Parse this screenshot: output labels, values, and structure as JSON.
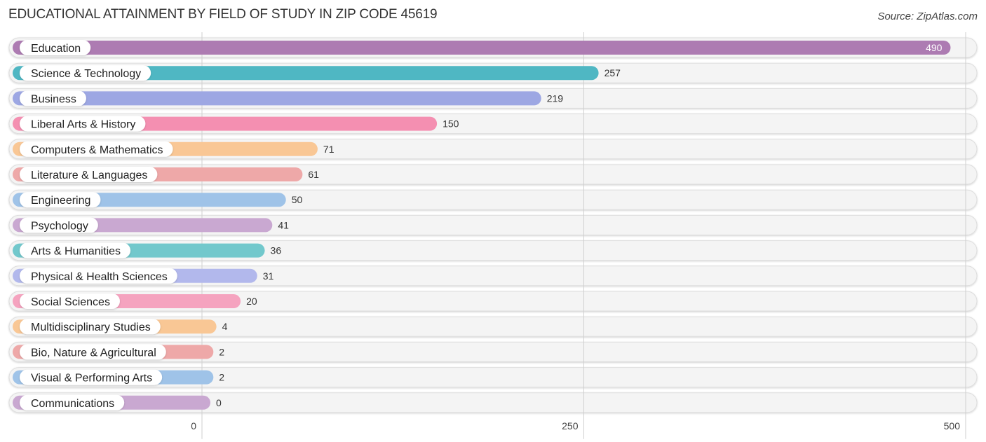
{
  "chart_data": {
    "type": "bar",
    "orientation": "horizontal",
    "title": "EDUCATIONAL ATTAINMENT BY FIELD OF STUDY IN ZIP CODE 45619",
    "source": "Source: ZipAtlas.com",
    "xlabel": "",
    "ylabel": "",
    "xlim": [
      0,
      500
    ],
    "xticks": [
      0,
      250,
      500
    ],
    "xtick_labels": [
      "0",
      "250",
      "500"
    ],
    "grid": true,
    "categories": [
      "Education",
      "Science & Technology",
      "Business",
      "Liberal Arts & History",
      "Computers & Mathematics",
      "Literature & Languages",
      "Engineering",
      "Psychology",
      "Arts & Humanities",
      "Physical & Health Sciences",
      "Social Sciences",
      "Multidisciplinary Studies",
      "Bio, Nature & Agricultural",
      "Visual & Performing Arts",
      "Communications"
    ],
    "values": [
      490,
      257,
      219,
      150,
      71,
      61,
      50,
      41,
      36,
      31,
      20,
      4,
      2,
      2,
      0
    ],
    "value_labels": [
      "490",
      "257",
      "219",
      "150",
      "71",
      "61",
      "50",
      "41",
      "36",
      "31",
      "20",
      "4",
      "2",
      "2",
      "0"
    ],
    "colors": [
      "#ad7bb2",
      "#4fb7c3",
      "#9da7e3",
      "#f48fb1",
      "#f9c795",
      "#eea8a8",
      "#9fc3e8",
      "#c9a8d1",
      "#72c8cc",
      "#b2b8ec",
      "#f5a3bf",
      "#f9c795",
      "#eea8a8",
      "#9fc3e8",
      "#c9a8d1"
    ]
  }
}
